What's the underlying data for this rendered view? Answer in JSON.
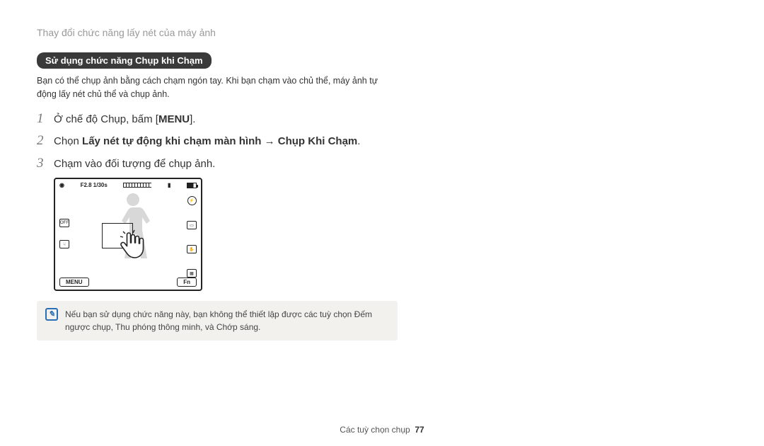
{
  "header": {
    "title": "Thay đổi chức năng lấy nét của máy ảnh"
  },
  "pill": {
    "label": "Sử dụng chức năng Chụp khi Chạm"
  },
  "intro": "Bạn có thể chụp ảnh bằng cách chạm ngón tay. Khi bạn chạm vào chủ thể, máy ảnh tự động lấy nét chủ thể và chụp ảnh.",
  "steps": [
    {
      "num": "1",
      "pre": "Ở chế độ Chụp, bấm [",
      "menu": "MENU",
      "post": "]."
    },
    {
      "num": "2",
      "pre": "Chọn ",
      "bold1": "Lấy nét tự động khi chạm màn hình",
      "arrow": " → ",
      "bold2": "Chụp Khi Chạm",
      "post": "."
    },
    {
      "num": "3",
      "text": "Chạm vào đối tượng để chụp ảnh."
    }
  ],
  "screen": {
    "exposure": "F2.8 1/30s",
    "menu_btn": "MENU",
    "fn_btn": "Fn"
  },
  "note": {
    "text": "Nếu bạn sử dụng chức năng này, bạn không thể thiết lập được các tuỳ chọn Đếm ngược chụp, Thu phóng thông minh, và Chớp sáng."
  },
  "footer": {
    "section": "Các tuỳ chọn chụp",
    "page": "77"
  }
}
